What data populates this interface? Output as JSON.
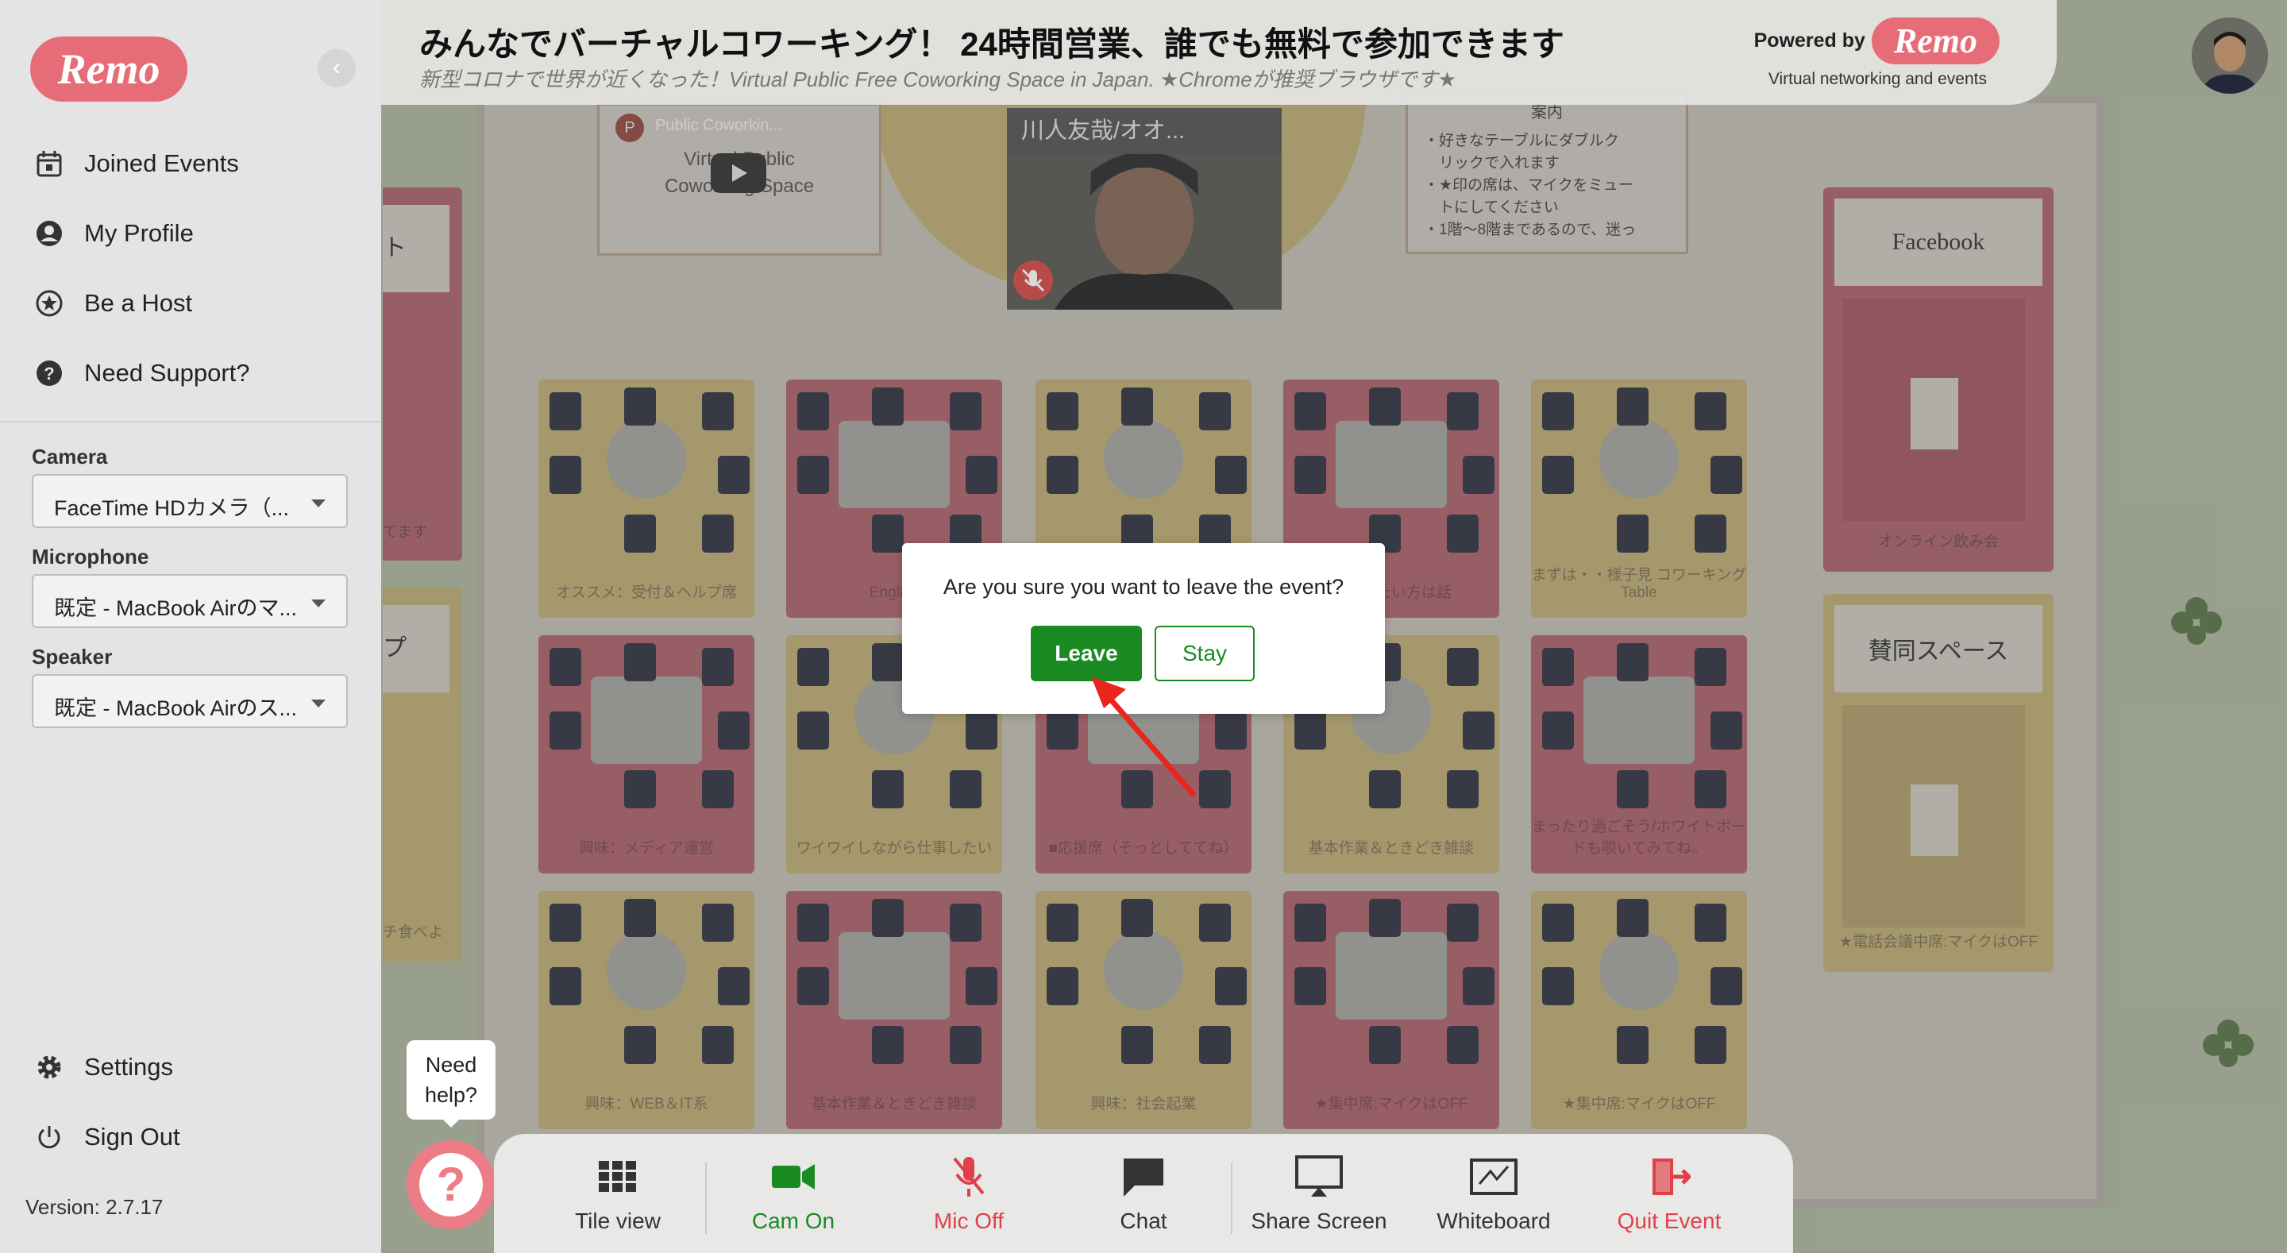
{
  "header": {
    "title": "みんなでバーチャルコワーキング！ 24時間営業、誰でも無料で参加できます",
    "subtitle": "新型コロナで世界が近くなった！Virtual Public Free Coworking Space in Japan.   ★Chromeが推奨ブラウザです★",
    "powered_by": "Powered by",
    "powered_logo": "Remo",
    "powered_sub": "Virtual networking and events"
  },
  "sidebar": {
    "logo": "Remo",
    "nav": [
      {
        "label": "Joined Events",
        "icon": "calendar-icon"
      },
      {
        "label": "My Profile",
        "icon": "profile-icon"
      },
      {
        "label": "Be a Host",
        "icon": "star-icon"
      },
      {
        "label": "Need Support?",
        "icon": "help-circle-icon"
      }
    ],
    "camera_label": "Camera",
    "camera_value": "FaceTime HDカメラ（...",
    "microphone_label": "Microphone",
    "microphone_value": "既定 - MacBook Airのマ...",
    "speaker_label": "Speaker",
    "speaker_value": "既定 - MacBook Airのス...",
    "settings": "Settings",
    "sign_out": "Sign Out",
    "version": "Version: 2.7.17"
  },
  "help": {
    "bubble_line1": "Need",
    "bubble_line2": "help?"
  },
  "stage": {
    "video_name": "川人友哉/オオ...",
    "yt_channel": "Public Coworkin...",
    "yt_text1": "Virtual Public",
    "yt_text2": "Coworking Space",
    "info_title": "案内",
    "info_lines": [
      "・好きなテーブルにダブルク",
      "　リックで入れます",
      "・★印の席は、マイクをミュー",
      "　トにしてください",
      "・1階～8階まであるので、迷っ"
    ],
    "left_card1_frag": "ト",
    "left_card1_label": "てます",
    "left_card2_frag": "プ",
    "left_card2_label": "チ食べよ",
    "tables": [
      {
        "label": "オススメ：受付＆ヘルプ席",
        "color": "yellow"
      },
      {
        "label": "English",
        "color": "red"
      },
      {
        "label": "",
        "color": "yellow"
      },
      {
        "label": "ットしたい方は話",
        "color": "red"
      },
      {
        "label": "まずは・・様子見 コワーキング Table",
        "color": "yellow"
      },
      {
        "label": "興味：メディア運営",
        "color": "red"
      },
      {
        "label": "ワイワイしながら仕事したい",
        "color": "yellow"
      },
      {
        "label": "■応援席（そっとしててね）",
        "color": "red"
      },
      {
        "label": "基本作業＆ときどき雑談",
        "color": "yellow"
      },
      {
        "label": "まったり過ごそう/ホワイトボードも覗いてみてね。",
        "color": "red"
      },
      {
        "label": "興味：WEB＆IT系",
        "color": "yellow"
      },
      {
        "label": "基本作業＆ときどき雑談",
        "color": "red"
      },
      {
        "label": "興味：社会起業",
        "color": "yellow"
      },
      {
        "label": "★集中席:マイクはOFF",
        "color": "red"
      },
      {
        "label": "★集中席:マイクはOFF",
        "color": "yellow"
      }
    ],
    "side_cards": [
      {
        "title": "Facebook",
        "label": "オンライン飲み会"
      },
      {
        "title": "賛同スペース",
        "label": "★電話会議中席:マイクはOFF"
      }
    ]
  },
  "modal": {
    "question": "Are you sure you want to leave the event?",
    "leave": "Leave",
    "stay": "Stay"
  },
  "toolbar": [
    {
      "label": "Tile view",
      "icon": "grid-icon",
      "color": "#333333"
    },
    {
      "label": "Cam On",
      "icon": "camera-icon",
      "color": "#1a8a22"
    },
    {
      "label": "Mic Off",
      "icon": "mic-off-icon",
      "color": "#e0404a"
    },
    {
      "label": "Chat",
      "icon": "chat-icon",
      "color": "#333333"
    },
    {
      "label": "Share Screen",
      "icon": "screen-share-icon",
      "color": "#333333"
    },
    {
      "label": "Whiteboard",
      "icon": "whiteboard-icon",
      "color": "#333333"
    },
    {
      "label": "Quit Event",
      "icon": "exit-icon",
      "color": "#e0404a"
    }
  ],
  "colors": {
    "brand": "#e66c78",
    "leave": "#1a8a22",
    "danger": "#e0404a"
  }
}
